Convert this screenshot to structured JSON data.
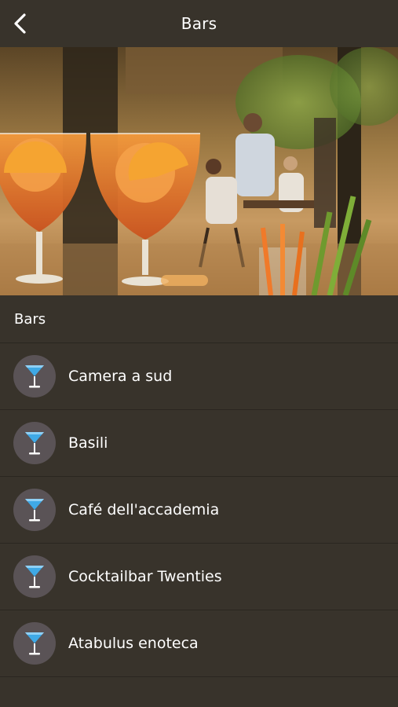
{
  "header": {
    "title": "Bars",
    "back_icon": "chevron-left-icon"
  },
  "section": {
    "title": "Bars"
  },
  "bars": [
    {
      "name": "Camera a sud",
      "icon": "cocktail-glass-icon"
    },
    {
      "name": "Basili",
      "icon": "cocktail-glass-icon"
    },
    {
      "name": "Café dell'accademia",
      "icon": "cocktail-glass-icon"
    },
    {
      "name": "Cocktailbar Twenties",
      "icon": "cocktail-glass-icon"
    },
    {
      "name": "Atabulus enoteca",
      "icon": "cocktail-glass-icon"
    }
  ],
  "colors": {
    "background": "#38332b",
    "icon_circle": "#5a5356",
    "cocktail_blue": "#3fa9e6"
  }
}
